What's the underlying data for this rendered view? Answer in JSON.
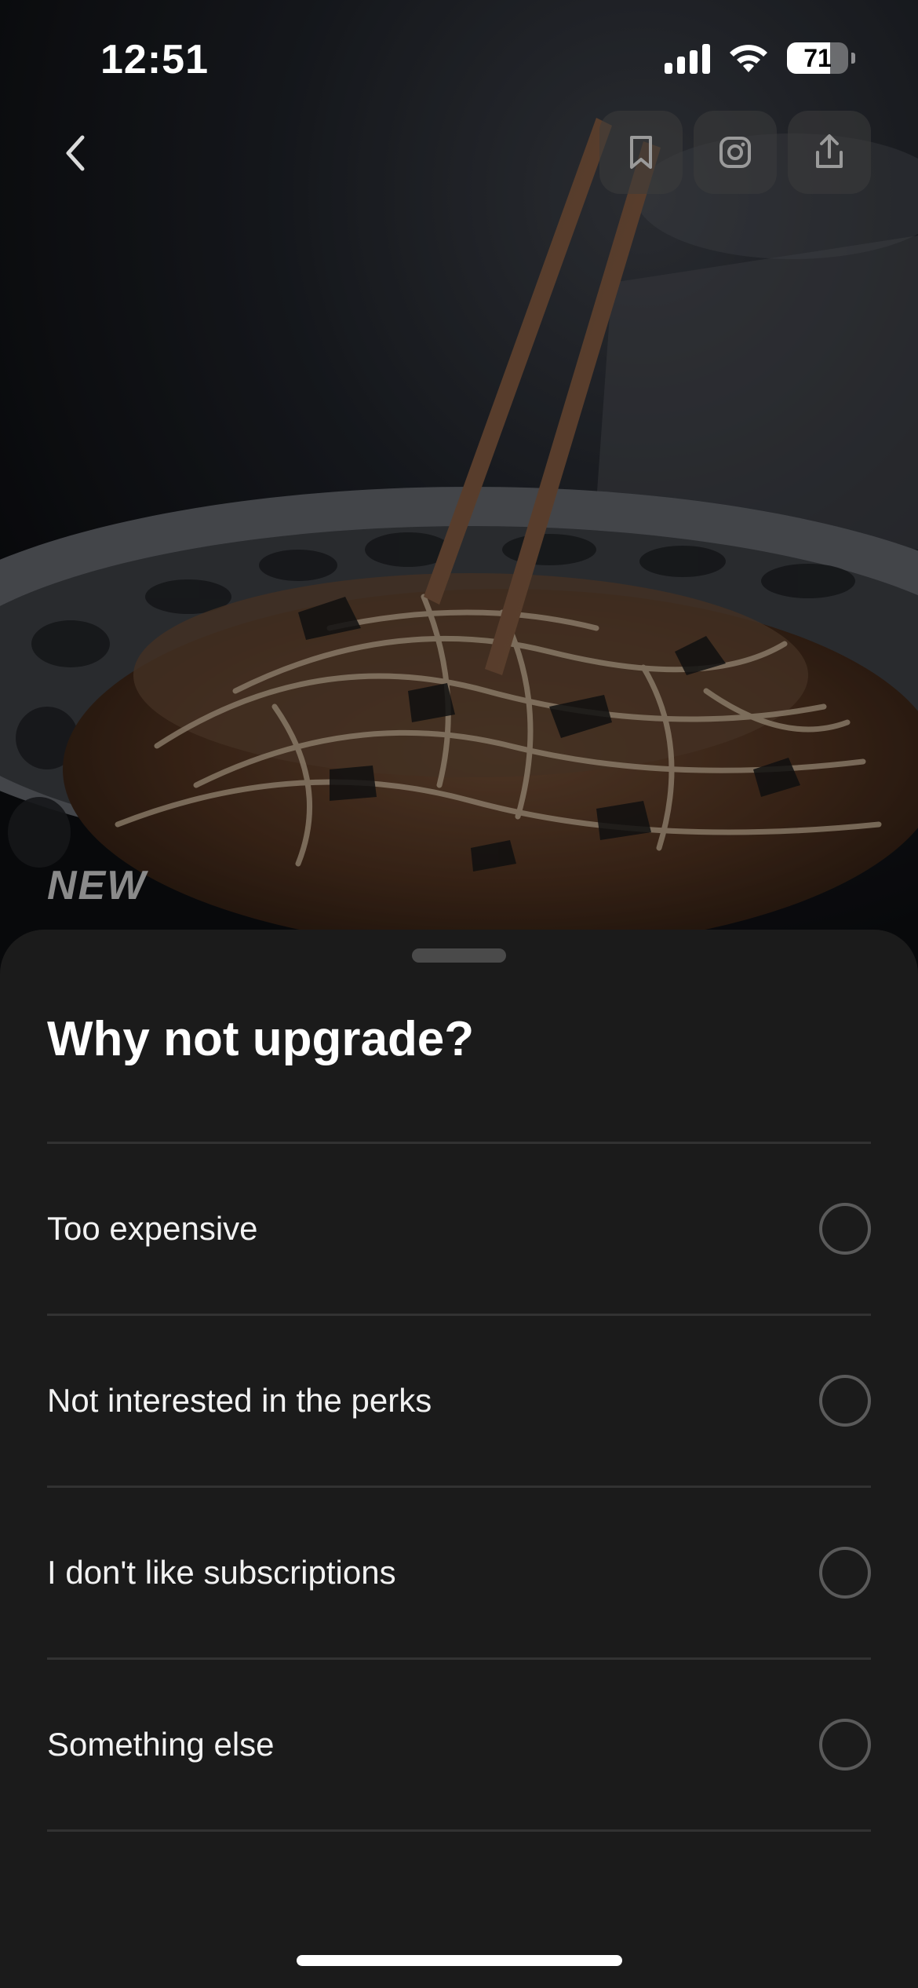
{
  "status_bar": {
    "time": "12:51",
    "battery_level": "71",
    "battery_fraction": 0.71,
    "icons": [
      "cellular-signal-icon",
      "wifi-icon",
      "battery-icon"
    ]
  },
  "hero": {
    "image_subject": "noodle dish lifted with chopsticks",
    "badge": "NEW"
  },
  "nav": {
    "back_icon": "chevron-left-icon",
    "actions": [
      "bookmark-icon",
      "instagram-icon",
      "share-icon"
    ]
  },
  "sheet": {
    "title": "Why not upgrade?",
    "options": [
      {
        "label": "Too expensive",
        "selected": false
      },
      {
        "label": "Not interested in the perks",
        "selected": false
      },
      {
        "label": "I don't like subscriptions",
        "selected": false
      },
      {
        "label": "Something else",
        "selected": false
      }
    ]
  },
  "colors": {
    "sheet_background": "#1b1b1b",
    "divider": "#323232",
    "text_primary": "#ffffff",
    "radio_border": "#5a5a5a",
    "badge_text": "#8a8a8a"
  }
}
